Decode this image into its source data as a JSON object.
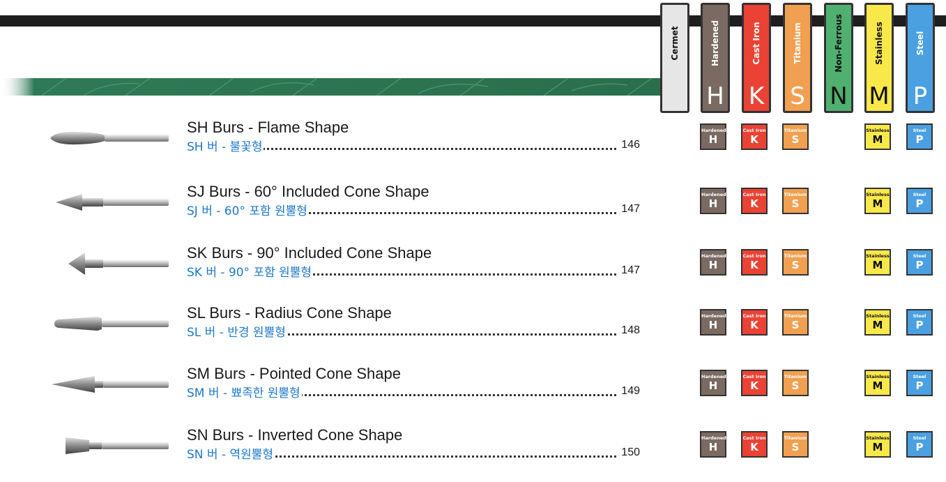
{
  "materials": [
    {
      "key": "cermet",
      "name": "Cermet",
      "letter": "",
      "color": "#e6e6e6",
      "text_color": "#111111"
    },
    {
      "key": "hardened",
      "name": "Hardened",
      "letter": "H",
      "color": "#7a6a62",
      "text_color": "#ffffff"
    },
    {
      "key": "castiron",
      "name": "Cast Iron",
      "letter": "K",
      "color": "#ea4234",
      "text_color": "#ffffff"
    },
    {
      "key": "titanium",
      "name": "Titanium",
      "letter": "S",
      "color": "#f0a050",
      "text_color": "#ffffff"
    },
    {
      "key": "nonferrous",
      "name": "Non-Ferrous",
      "letter": "N",
      "color": "#50b070",
      "text_color": "#111111"
    },
    {
      "key": "stainless",
      "name": "Stainless",
      "letter": "M",
      "color": "#f8e84a",
      "text_color": "#111111"
    },
    {
      "key": "steel",
      "name": "Steel",
      "letter": "P",
      "color": "#4aa0e0",
      "text_color": "#ffffff"
    }
  ],
  "products": [
    {
      "title": "SH Burs - Flame Shape",
      "korean": "SH 버 - 불꽃형",
      "page": "146",
      "tool": "flame",
      "badges": [
        "hardened",
        "castiron",
        "titanium",
        "stainless",
        "steel"
      ]
    },
    {
      "title": "SJ Burs - 60° Included Cone Shape",
      "korean": "SJ 버 - 60° 포함 원뿔형",
      "page": "147",
      "tool": "cone60",
      "badges": [
        "hardened",
        "castiron",
        "titanium",
        "stainless",
        "steel"
      ]
    },
    {
      "title": "SK Burs - 90° Included Cone Shape",
      "korean": "SK 버 - 90° 포함 원뿔형",
      "page": "147",
      "tool": "cone90",
      "badges": [
        "hardened",
        "castiron",
        "titanium",
        "stainless",
        "steel"
      ]
    },
    {
      "title": "SL Burs - Radius Cone Shape",
      "korean": "SL 버 - 반경 원뿔형",
      "page": "148",
      "tool": "radius",
      "badges": [
        "hardened",
        "castiron",
        "titanium",
        "stainless",
        "steel"
      ]
    },
    {
      "title": "SM Burs - Pointed Cone Shape",
      "korean": "SM 버 - 뾰족한 원뿔형",
      "page": "149",
      "tool": "pointed",
      "badges": [
        "hardened",
        "castiron",
        "titanium",
        "stainless",
        "steel"
      ]
    },
    {
      "title": "SN Burs - Inverted Cone Shape",
      "korean": "SN 버 - 역원뿔형",
      "page": "150",
      "tool": "inverted",
      "badges": [
        "hardened",
        "castiron",
        "titanium",
        "stainless",
        "steel"
      ]
    }
  ]
}
